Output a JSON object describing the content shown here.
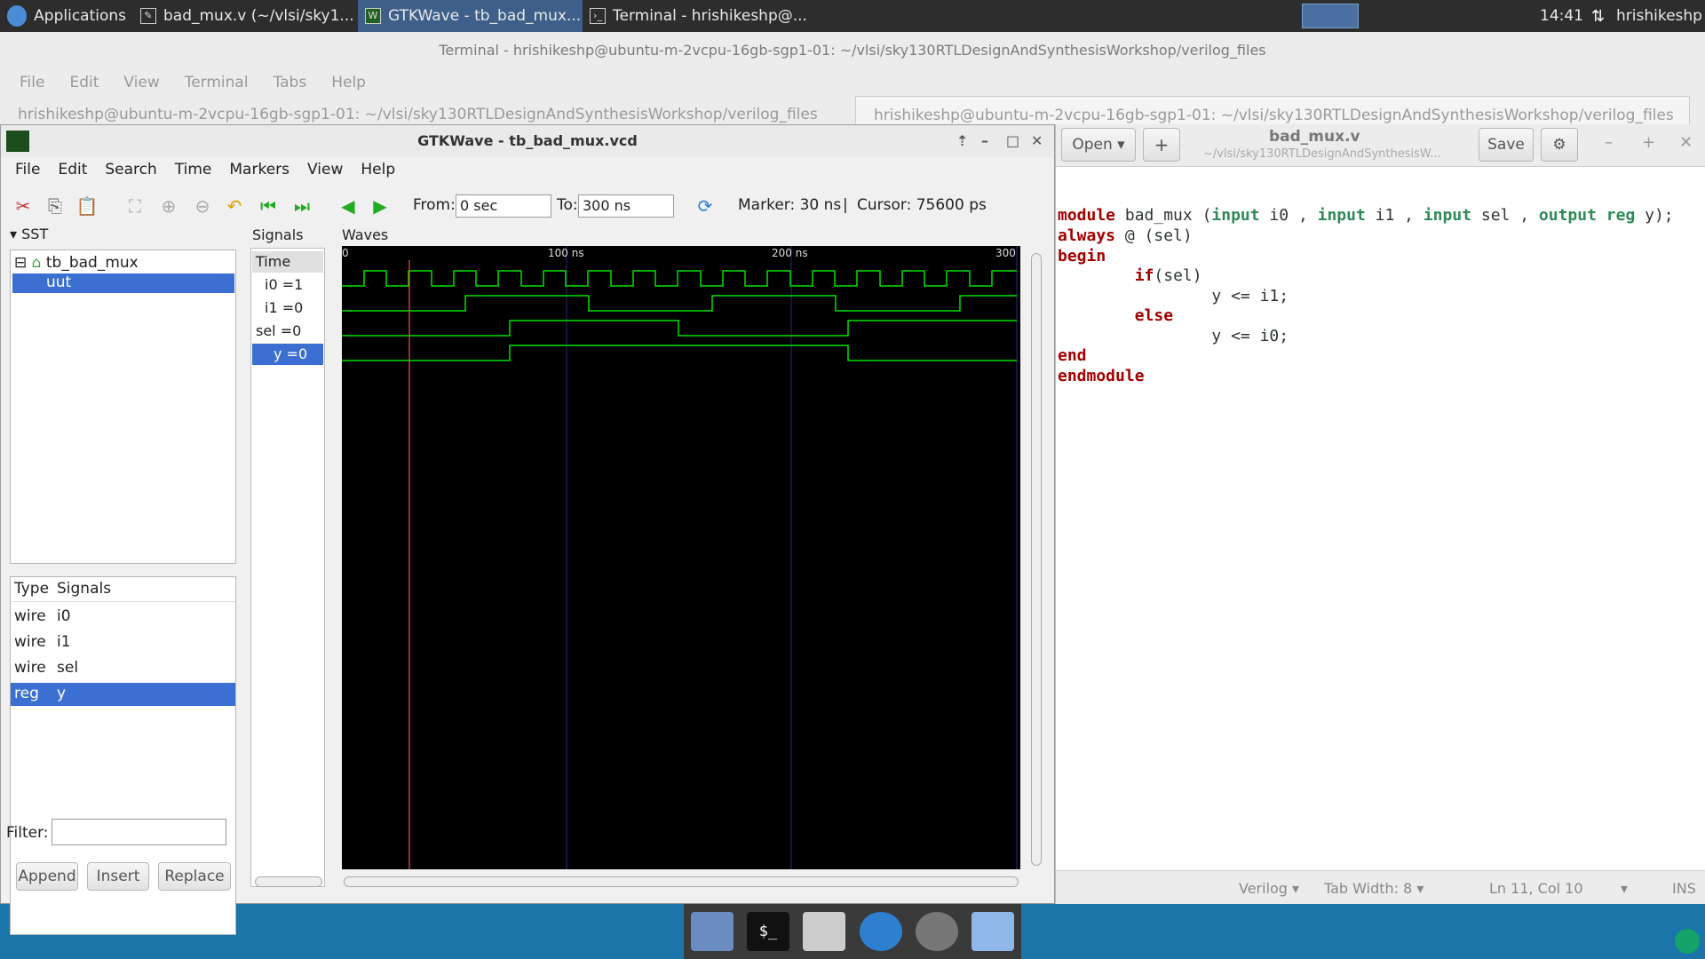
{
  "panel": {
    "apps": "Applications",
    "tasks": [
      "bad_mux.v (~/vlsi/sky1...",
      "GTKWave - tb_bad_mux...",
      "Terminal - hrishikeshp@..."
    ],
    "clock": "14:41",
    "user": "hrishikeshp"
  },
  "terminal": {
    "title": "Terminal - hrishikeshp@ubuntu-m-2vcpu-16gb-sgp1-01: ~/vlsi/sky130RTLDesignAndSynthesisWorkshop/verilog_files",
    "menu": [
      "File",
      "Edit",
      "View",
      "Terminal",
      "Tabs",
      "Help"
    ],
    "tab1": "hrishikeshp@ubuntu-m-2vcpu-16gb-sgp1-01: ~/vlsi/sky130RTLDesignAndSynthesisWorkshop/verilog_files",
    "tab2": "hrishikeshp@ubuntu-m-2vcpu-16gb-sgp1-01: ~/vlsi/sky130RTLDesignAndSynthesisWorkshop/verilog_files"
  },
  "gtkwave": {
    "title": "GTKWave - tb_bad_mux.vcd",
    "menu": [
      "File",
      "Edit",
      "Search",
      "Time",
      "Markers",
      "View",
      "Help"
    ],
    "from_label": "From:",
    "from_value": "0 sec",
    "to_label": "To:",
    "to_value": "300 ns",
    "marker": "Marker: 30 ns",
    "sep": "|",
    "cursor": "Cursor: 75600 ps",
    "sst": "SST",
    "tree": [
      "tb_bad_mux",
      "uut"
    ],
    "signals_header": "Signals",
    "waves_header": "Waves",
    "time_label": "Time",
    "signal_rows": [
      "i0 =1",
      "i1 =0",
      "sel =0",
      "y =0"
    ],
    "type_col": "Type",
    "signals_col": "Signals",
    "table": [
      [
        "wire",
        "i0"
      ],
      [
        "wire",
        "i1"
      ],
      [
        "wire",
        "sel"
      ],
      [
        "reg",
        "y"
      ]
    ],
    "filter_label": "Filter:",
    "buttons": [
      "Append",
      "Insert",
      "Replace"
    ],
    "time_ticks": [
      "0",
      "100 ns",
      "200 ns",
      "300"
    ]
  },
  "editor": {
    "open": "Open",
    "title": "bad_mux.v",
    "path": "~/vlsi/sky130RTLDesignAndSynthesisW...",
    "save": "Save",
    "status": {
      "lang": "Verilog",
      "tab": "Tab Width: 8",
      "pos": "Ln 11, Col 10",
      "mode": "INS"
    }
  },
  "colors": {
    "wave": "#00e000",
    "wave_bg": "#000000",
    "marker": "#ff4d4d",
    "grid": "#2a2a8a"
  }
}
